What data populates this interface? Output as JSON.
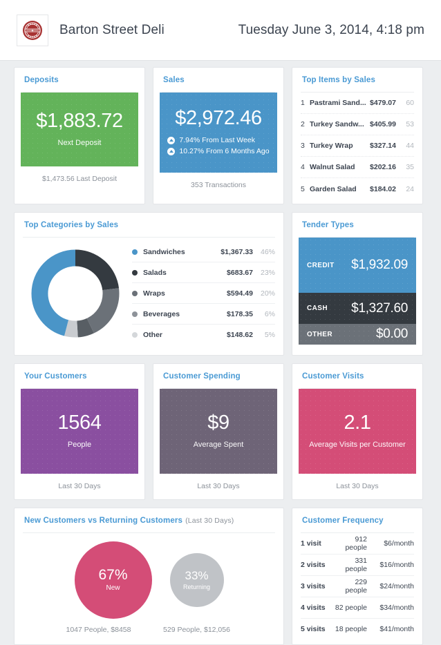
{
  "header": {
    "logo_icon": "stamp-badge-logo",
    "brand": "Barton Street Deli",
    "datetime": "Tuesday June 3, 2014, 4:18 pm"
  },
  "colors": {
    "accent_blue": "#4a9ad4",
    "green": "#63b35a",
    "blue": "#4a95c8",
    "charcoal": "#343a40",
    "gray_mid": "#6b7178",
    "gray_light": "#c9ccd0",
    "purple": "#8a4fa0",
    "gray_purple": "#6e6477",
    "pink": "#d44d77",
    "logo_red": "#a83232"
  },
  "deposits": {
    "title": "Deposits",
    "value": "$1,883.72",
    "label": "Next Deposit",
    "footer": "$1,473.56 Last Deposit"
  },
  "sales": {
    "title": "Sales",
    "value": "$2,972.46",
    "footer": "353 Transactions",
    "deltas": [
      {
        "icon": "arrow-up-circle-icon",
        "text": "7.94% From Last Week"
      },
      {
        "icon": "arrow-up-circle-icon",
        "text": "10.27% From 6 Months Ago"
      }
    ]
  },
  "top_items": {
    "title": "Top Items by Sales",
    "rows": [
      {
        "rank": "1",
        "name": "Pastrami Sand...",
        "amount": "$479.07",
        "qty": "60"
      },
      {
        "rank": "2",
        "name": "Turkey Sandw...",
        "amount": "$405.99",
        "qty": "53"
      },
      {
        "rank": "3",
        "name": "Turkey Wrap",
        "amount": "$327.14",
        "qty": "44"
      },
      {
        "rank": "4",
        "name": "Walnut Salad",
        "amount": "$202.16",
        "qty": "35"
      },
      {
        "rank": "5",
        "name": "Garden Salad",
        "amount": "$184.02",
        "qty": "24"
      }
    ]
  },
  "top_categories": {
    "title": "Top Categories by Sales",
    "rows": [
      {
        "name": "Sandwiches",
        "amount": "$1,367.33",
        "percent": "46%"
      },
      {
        "name": "Salads",
        "amount": "$683.67",
        "percent": "23%"
      },
      {
        "name": "Wraps",
        "amount": "$594.49",
        "percent": "20%"
      },
      {
        "name": "Beverages",
        "amount": "$178.35",
        "percent": "6%"
      },
      {
        "name": "Other",
        "amount": "$148.62",
        "percent": "5%"
      }
    ]
  },
  "tender_types": {
    "title": "Tender Types",
    "rows": [
      {
        "name": "CREDIT",
        "amount": "$1,932.09"
      },
      {
        "name": "CASH",
        "amount": "$1,327.60"
      },
      {
        "name": "OTHER",
        "amount": "$0.00"
      }
    ]
  },
  "your_customers": {
    "title": "Your Customers",
    "value": "1564",
    "label": "People",
    "footer": "Last 30 Days"
  },
  "customer_spending": {
    "title": "Customer Spending",
    "value": "$9",
    "label": "Average Spent",
    "footer": "Last 30 Days"
  },
  "customer_visits": {
    "title": "Customer Visits",
    "value": "2.1",
    "label": "Average Visits per Customer",
    "footer": "Last 30 Days"
  },
  "new_vs_returning": {
    "title": "New Customers vs Returning Customers",
    "subtitle": "(Last 30 Days)",
    "new": {
      "percent": "67%",
      "label": "New",
      "footer": "1047 People, $8458"
    },
    "returning": {
      "percent": "33%",
      "label": "Returning",
      "footer": "529 People, $12,056"
    }
  },
  "customer_frequency": {
    "title": "Customer Frequency",
    "rows": [
      {
        "visits": "1 visit",
        "people": "912 people",
        "spend": "$6/month"
      },
      {
        "visits": "2 visits",
        "people": "331 people",
        "spend": "$16/month"
      },
      {
        "visits": "3 visits",
        "people": "229 people",
        "spend": "$24/month"
      },
      {
        "visits": "4 visits",
        "people": "82 people",
        "spend": "$34/month"
      },
      {
        "visits": "5 visits",
        "people": "18 people",
        "spend": "$41/month"
      }
    ]
  },
  "chart_data": [
    {
      "type": "pie",
      "title": "Top Categories by Sales",
      "labels": [
        "Sandwiches",
        "Salads",
        "Wraps",
        "Beverages",
        "Other"
      ],
      "values": [
        1367.33,
        683.67,
        594.49,
        178.35,
        148.62
      ],
      "percents": [
        46,
        23,
        20,
        6,
        5
      ],
      "colors": [
        "#4a95c8",
        "#343a40",
        "#6b7178",
        "#585e64",
        "#c9ccd0"
      ],
      "donut": true,
      "legend": "right"
    },
    {
      "type": "bar",
      "title": "Tender Types",
      "categories": [
        "CREDIT",
        "CASH",
        "OTHER"
      ],
      "values": [
        1932.09,
        1327.6,
        0.0
      ],
      "colors": [
        "#4a95c8",
        "#343a40",
        "#6b7178"
      ],
      "orientation": "stacked-vertical"
    },
    {
      "type": "pie",
      "title": "New Customers vs Returning Customers",
      "labels": [
        "New",
        "Returning"
      ],
      "values": [
        67,
        33
      ],
      "people": [
        1047,
        529
      ],
      "spend": [
        "$8458",
        "$12,056"
      ],
      "colors": [
        "#d44d77",
        "#c0c3c7"
      ],
      "style": "proportional-bubbles"
    },
    {
      "type": "table",
      "title": "Customer Frequency",
      "categories": [
        "1 visit",
        "2 visits",
        "3 visits",
        "4 visits",
        "5 visits"
      ],
      "series": [
        {
          "name": "people",
          "values": [
            912,
            331,
            229,
            82,
            18
          ]
        },
        {
          "name": "spend_per_month",
          "values": [
            6,
            16,
            24,
            34,
            41
          ]
        }
      ]
    },
    {
      "type": "table",
      "title": "Top Items by Sales",
      "categories": [
        "Pastrami Sand...",
        "Turkey Sandw...",
        "Turkey Wrap",
        "Walnut Salad",
        "Garden Salad"
      ],
      "series": [
        {
          "name": "sales",
          "values": [
            479.07,
            405.99,
            327.14,
            202.16,
            184.02
          ]
        },
        {
          "name": "quantity",
          "values": [
            60,
            53,
            44,
            35,
            24
          ]
        }
      ]
    }
  ]
}
